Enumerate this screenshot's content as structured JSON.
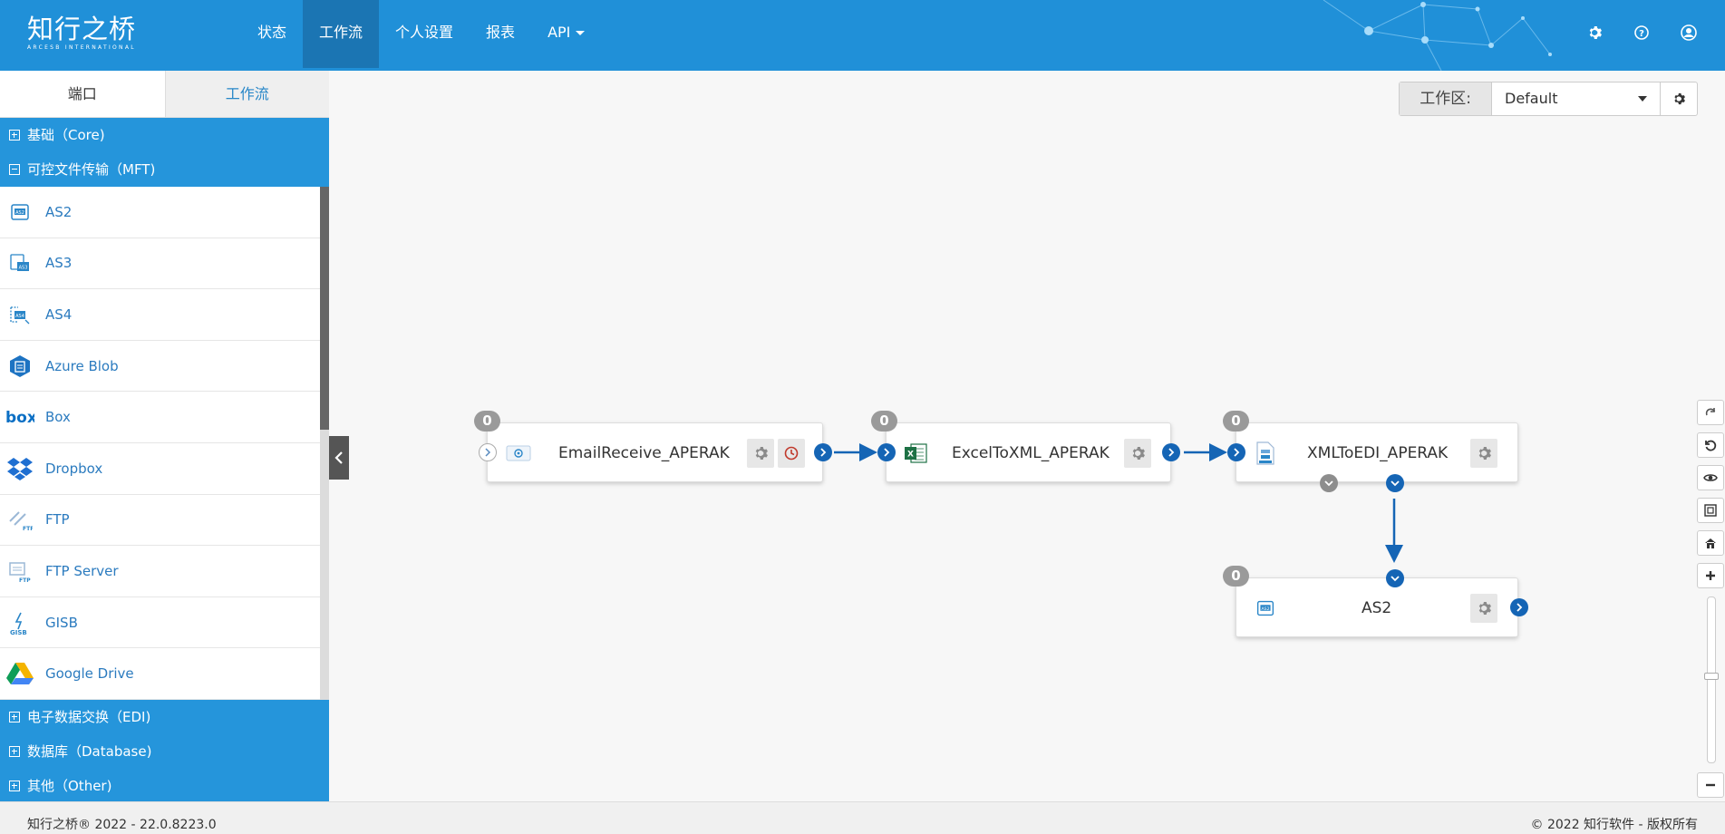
{
  "app": {
    "logo_text": "知行之桥",
    "logo_subtext": "ARCESB INTERNATIONAL"
  },
  "nav": {
    "items": [
      {
        "label": "状态"
      },
      {
        "label": "工作流"
      },
      {
        "label": "个人设置"
      },
      {
        "label": "报表"
      },
      {
        "label": "API"
      }
    ],
    "active": "工作流"
  },
  "sidebar": {
    "tabs": [
      {
        "label": "端口"
      },
      {
        "label": "工作流"
      }
    ],
    "categories_top": [
      {
        "label": "基础（Core)",
        "expanded": false
      },
      {
        "label": "可控文件传输（MFT)",
        "expanded": true
      }
    ],
    "items": [
      {
        "label": "AS2",
        "icon": "as2-icon"
      },
      {
        "label": "AS3",
        "icon": "as3-icon"
      },
      {
        "label": "AS4",
        "icon": "as4-icon"
      },
      {
        "label": "Azure Blob",
        "icon": "azure-blob-icon"
      },
      {
        "label": "Box",
        "icon": "box-icon"
      },
      {
        "label": "Dropbox",
        "icon": "dropbox-icon"
      },
      {
        "label": "FTP",
        "icon": "ftp-icon"
      },
      {
        "label": "FTP Server",
        "icon": "ftp-server-icon"
      },
      {
        "label": "GISB",
        "icon": "gisb-icon"
      },
      {
        "label": "Google Drive",
        "icon": "google-drive-icon"
      }
    ],
    "categories_bottom": [
      {
        "label": "电子数据交换（EDI)",
        "expanded": false
      },
      {
        "label": "数据库（Database)",
        "expanded": false
      },
      {
        "label": "其他（Other)",
        "expanded": false
      }
    ]
  },
  "workspace": {
    "label": "工作区:",
    "value": "Default"
  },
  "flow": {
    "nodes": [
      {
        "name": "EmailReceive_APERAK",
        "count": "0",
        "icon": "email-icon"
      },
      {
        "name": "ExcelToXML_APERAK",
        "count": "0",
        "icon": "excel-icon"
      },
      {
        "name": "XMLToEDI_APERAK",
        "count": "0",
        "icon": "xml-edi-icon"
      },
      {
        "name": "AS2",
        "count": "0",
        "icon": "as2-icon"
      }
    ]
  },
  "colors": {
    "header": "#2090d8",
    "accent": "#1565b5",
    "category": "#2595db"
  },
  "footer": {
    "version": "知行之桥® 2022 - 22.0.8223.0",
    "copyright": "© 2022 知行软件 - 版权所有"
  }
}
